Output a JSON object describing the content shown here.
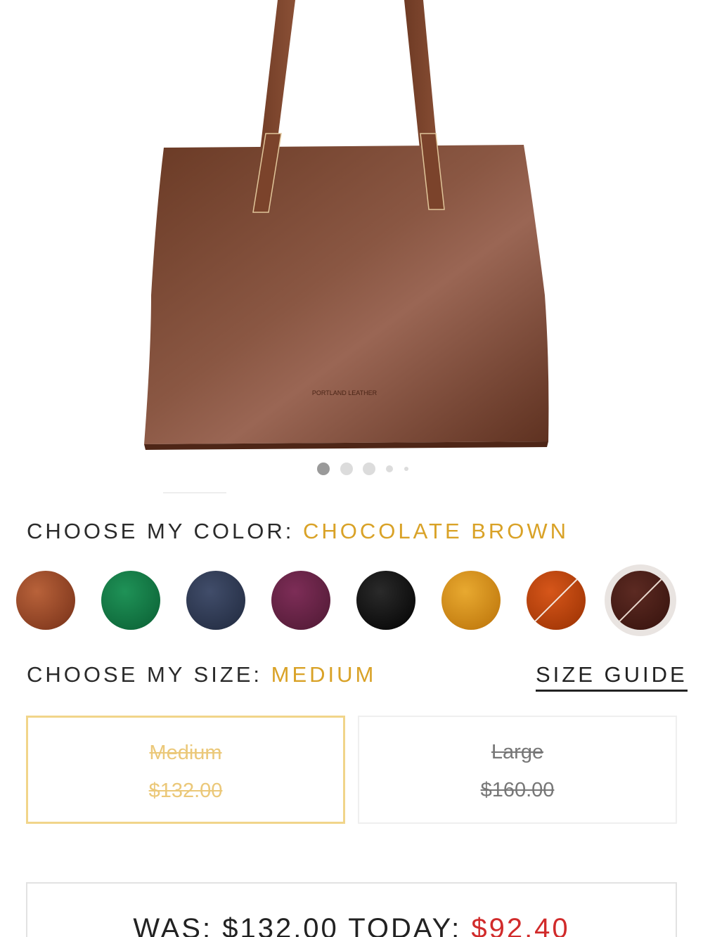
{
  "product_image": {
    "alt": "Chocolate brown leather tote bag",
    "brand_stamp": "PORTLAND LEATHER"
  },
  "carousel": {
    "total": 5,
    "active_index": 0
  },
  "color": {
    "prefix": "CHOOSE MY COLOR:",
    "selected": "CHOCOLATE BROWN",
    "swatches": [
      {
        "name": "tan-pebbled",
        "hex": "#9a4a2b"
      },
      {
        "name": "green",
        "hex": "#147a47"
      },
      {
        "name": "navy",
        "hex": "#2f3a55"
      },
      {
        "name": "plum",
        "hex": "#6b2549"
      },
      {
        "name": "black",
        "hex": "#141414"
      },
      {
        "name": "honey",
        "hex": "#d9951e"
      },
      {
        "name": "orange",
        "hex": "#c24a0d",
        "unavailable": true
      },
      {
        "name": "chocolate-brown",
        "hex": "#4b1f19",
        "unavailable": true,
        "selected": true
      }
    ]
  },
  "size": {
    "prefix": "CHOOSE MY SIZE:",
    "selected": "MEDIUM",
    "guide_link": "SIZE GUIDE",
    "options": [
      {
        "name": "Medium",
        "price": "$132.00"
      },
      {
        "name": "Large",
        "price": "$160.00"
      }
    ]
  },
  "pricing": {
    "was_label": "WAS:",
    "was_price": "$132.00",
    "today_label": "TODAY:",
    "today_price": "$92.40"
  },
  "colors": {
    "accent": "#d9a227",
    "sale_red": "#d12b2b",
    "medium_border": "#f1d58a"
  }
}
